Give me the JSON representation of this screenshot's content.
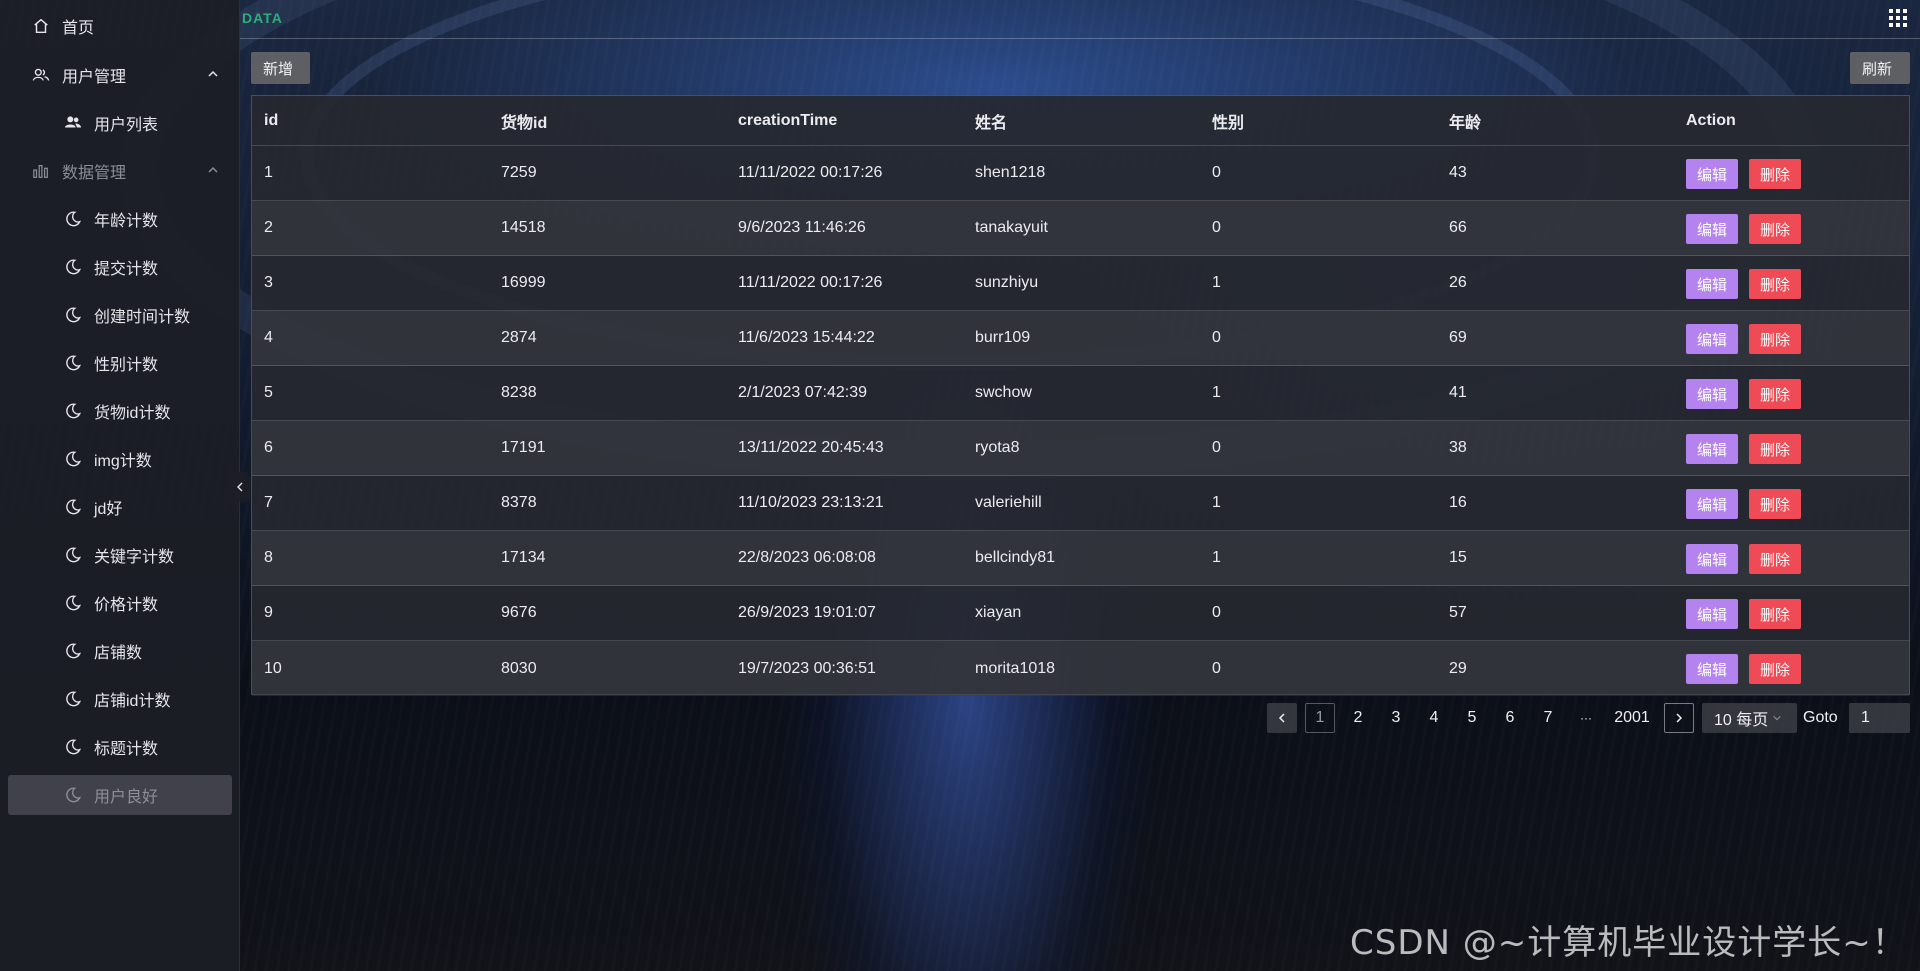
{
  "brand": "DATA",
  "sidebar": {
    "items": [
      {
        "label": "首页",
        "icon": "home-icon"
      },
      {
        "label": "用户管理",
        "icon": "users-icon"
      },
      {
        "label": "用户列表",
        "icon": "user-group-icon"
      },
      {
        "label": "数据管理",
        "icon": "bar-chart-icon"
      },
      {
        "label": "年龄计数",
        "icon": "moon-icon"
      },
      {
        "label": "提交计数",
        "icon": "moon-icon"
      },
      {
        "label": "创建时间计数",
        "icon": "moon-icon"
      },
      {
        "label": "性别计数",
        "icon": "moon-icon"
      },
      {
        "label": "货物id计数",
        "icon": "moon-icon"
      },
      {
        "label": "img计数",
        "icon": "moon-icon"
      },
      {
        "label": "jd好",
        "icon": "moon-icon"
      },
      {
        "label": "关键字计数",
        "icon": "moon-icon"
      },
      {
        "label": "价格计数",
        "icon": "moon-icon"
      },
      {
        "label": "店铺数",
        "icon": "moon-icon"
      },
      {
        "label": "店铺id计数",
        "icon": "moon-icon"
      },
      {
        "label": "标题计数",
        "icon": "moon-icon"
      },
      {
        "label": "用户良好",
        "icon": "moon-icon"
      }
    ]
  },
  "toolbar": {
    "add_label": "新增",
    "refresh_label": "刷新"
  },
  "table": {
    "headers": [
      "id",
      "货物id",
      "creationTime",
      "姓名",
      "性别",
      "年龄",
      "Action"
    ],
    "edit_label": "编辑",
    "delete_label": "删除",
    "rows": [
      [
        "1",
        "7259",
        "11/11/2022 00:17:26",
        "shen1218",
        "0",
        "43"
      ],
      [
        "2",
        "14518",
        "9/6/2023 11:46:26",
        "tanakayuit",
        "0",
        "66"
      ],
      [
        "3",
        "16999",
        "11/11/2022 00:17:26",
        "sunzhiyu",
        "1",
        "26"
      ],
      [
        "4",
        "2874",
        "11/6/2023 15:44:22",
        "burr109",
        "0",
        "69"
      ],
      [
        "5",
        "8238",
        "2/1/2023 07:42:39",
        "swchow",
        "1",
        "41"
      ],
      [
        "6",
        "17191",
        "13/11/2022 20:45:43",
        "ryota8",
        "0",
        "38"
      ],
      [
        "7",
        "8378",
        "11/10/2023 23:13:21",
        "valeriehill",
        "1",
        "16"
      ],
      [
        "8",
        "17134",
        "22/8/2023 06:08:08",
        "bellcindy81",
        "1",
        "15"
      ],
      [
        "9",
        "9676",
        "26/9/2023 19:01:07",
        "xiayan",
        "0",
        "57"
      ],
      [
        "10",
        "8030",
        "19/7/2023 00:36:51",
        "morita1018",
        "0",
        "29"
      ]
    ]
  },
  "pagination": {
    "pages": [
      "1",
      "2",
      "3",
      "4",
      "5",
      "6",
      "7",
      "···",
      "2001"
    ],
    "current": "1",
    "page_size": "10 每页",
    "goto_label": "Goto",
    "goto_value": "1"
  },
  "colors": {
    "edit": "#b483f0",
    "delete": "#ef4b56",
    "brand": "#29b07a"
  },
  "watermark": "CSDN @~计算机毕业设计学长~！"
}
